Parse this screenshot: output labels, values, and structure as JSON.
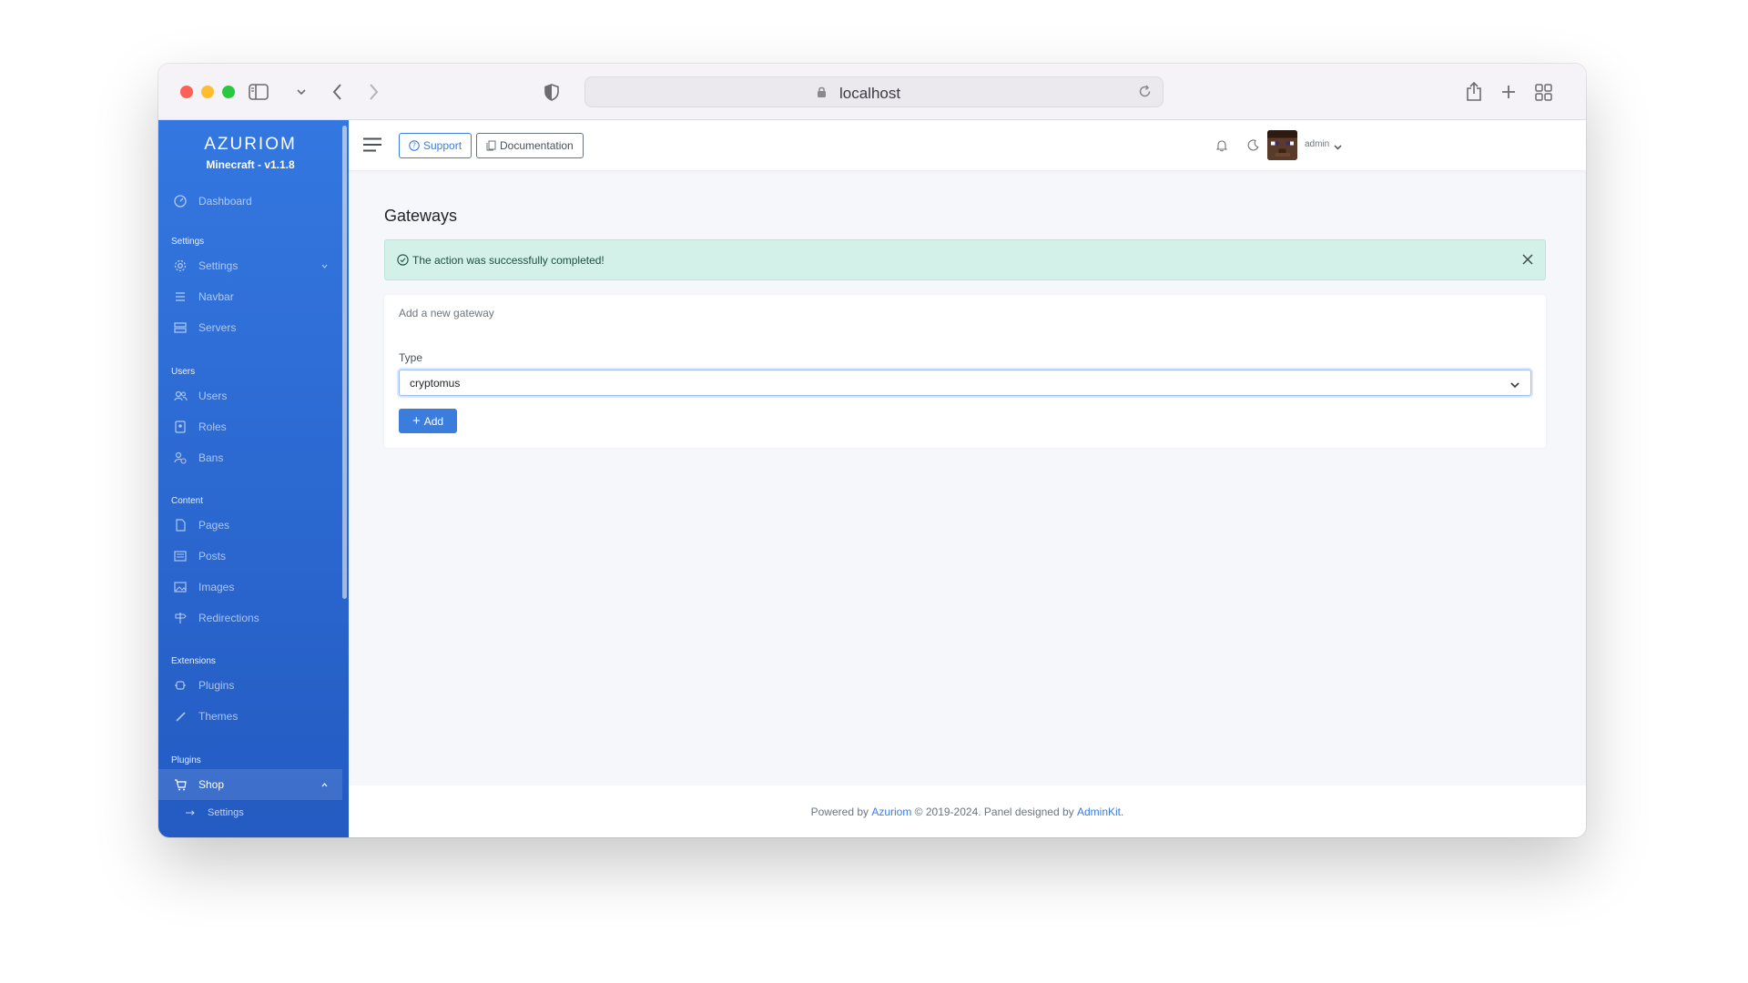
{
  "browser": {
    "url": "localhost"
  },
  "sidebar": {
    "brand_logo": "AZURIOM",
    "brand_version": "Minecraft - v1.1.8",
    "dashboard": "Dashboard",
    "sections": {
      "settings": "Settings",
      "users": "Users",
      "content": "Content",
      "extensions": "Extensions",
      "plugins": "Plugins"
    },
    "items": {
      "settings": "Settings",
      "navbar": "Navbar",
      "servers": "Servers",
      "users": "Users",
      "roles": "Roles",
      "bans": "Bans",
      "pages": "Pages",
      "posts": "Posts",
      "images": "Images",
      "redirections": "Redirections",
      "plugins": "Plugins",
      "themes": "Themes",
      "shop": "Shop",
      "shop_settings": "Settings"
    }
  },
  "navbar": {
    "support": "Support",
    "documentation": "Documentation",
    "user": "admin"
  },
  "main": {
    "title": "Gateways",
    "alert": "The action was successfully completed!",
    "card_title": "Add a new gateway",
    "type_label": "Type",
    "type_value": "cryptomus",
    "add_button": "Add"
  },
  "footer": {
    "prefix": "Powered by ",
    "azuriom": "Azuriom",
    "middle": " © 2019-2024. Panel designed by ",
    "adminkit": "AdminKit",
    "suffix": "."
  },
  "colors": {
    "primary": "#3b7ddd",
    "sidebar_top": "#3477e0",
    "sidebar_bottom": "#235bc2",
    "alert_bg": "#d3f1e8"
  }
}
